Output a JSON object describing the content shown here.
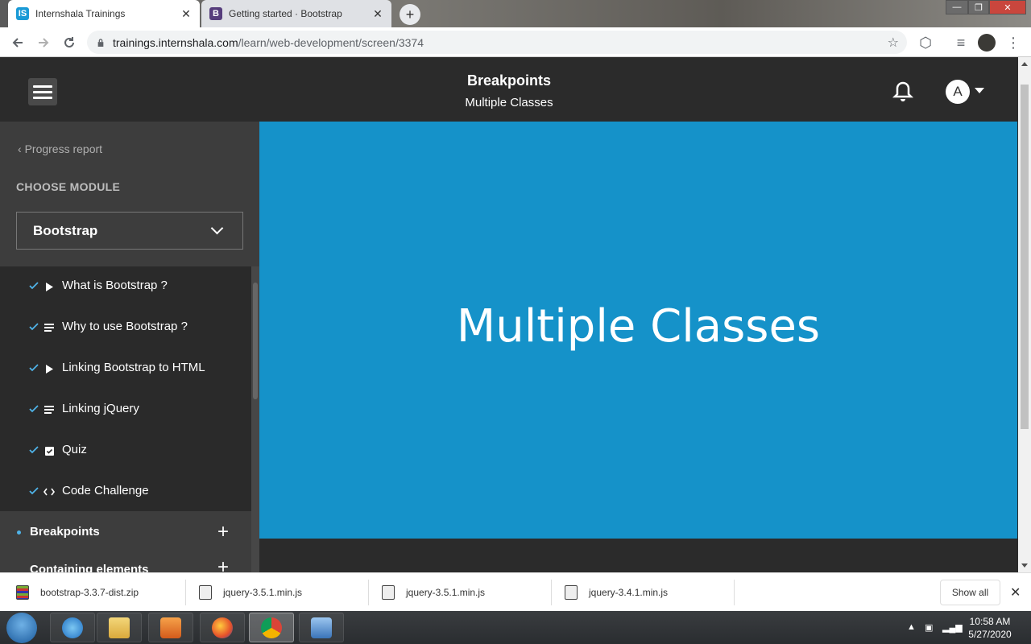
{
  "browser": {
    "tabs": [
      {
        "title": "Internshala Trainings",
        "favicon": "IS",
        "favicon_color": "#1a9ad6"
      },
      {
        "title": "Getting started · Bootstrap",
        "favicon": "B",
        "favicon_color": "#563d7c"
      }
    ],
    "new_tab_label": "+",
    "url_host": "trainings.internshala.com",
    "url_path": "/learn/web-development/screen/3374"
  },
  "header": {
    "title": "Breakpoints",
    "subtitle": "Multiple Classes",
    "avatar_letter": "A"
  },
  "sidebar": {
    "back_link": "Progress report",
    "choose_label": "CHOOSE MODULE",
    "selected_module": "Bootstrap",
    "lessons": [
      {
        "label": "What is Bootstrap ?",
        "type": "video-icon",
        "done": true
      },
      {
        "label": "Why to use Bootstrap ?",
        "type": "text-icon",
        "done": true
      },
      {
        "label": "Linking Bootstrap to HTML",
        "type": "video-icon",
        "done": true
      },
      {
        "label": "Linking jQuery",
        "type": "text-icon",
        "done": true
      },
      {
        "label": "Quiz",
        "type": "quiz-icon",
        "done": true
      },
      {
        "label": "Code Challenge",
        "type": "code-icon",
        "done": true
      }
    ],
    "current_section": "Breakpoints",
    "next_section": "Containing elements"
  },
  "main": {
    "slide_text": "Multiple Classes",
    "slide_color": "#1592c9"
  },
  "downloads": {
    "items": [
      "bootstrap-3.3.7-dist.zip",
      "jquery-3.5.1.min.js",
      "jquery-3.5.1.min.js",
      "jquery-3.4.1.min.js"
    ],
    "show_all": "Show all"
  },
  "taskbar": {
    "time": "10:58 AM",
    "date": "5/27/2020"
  }
}
